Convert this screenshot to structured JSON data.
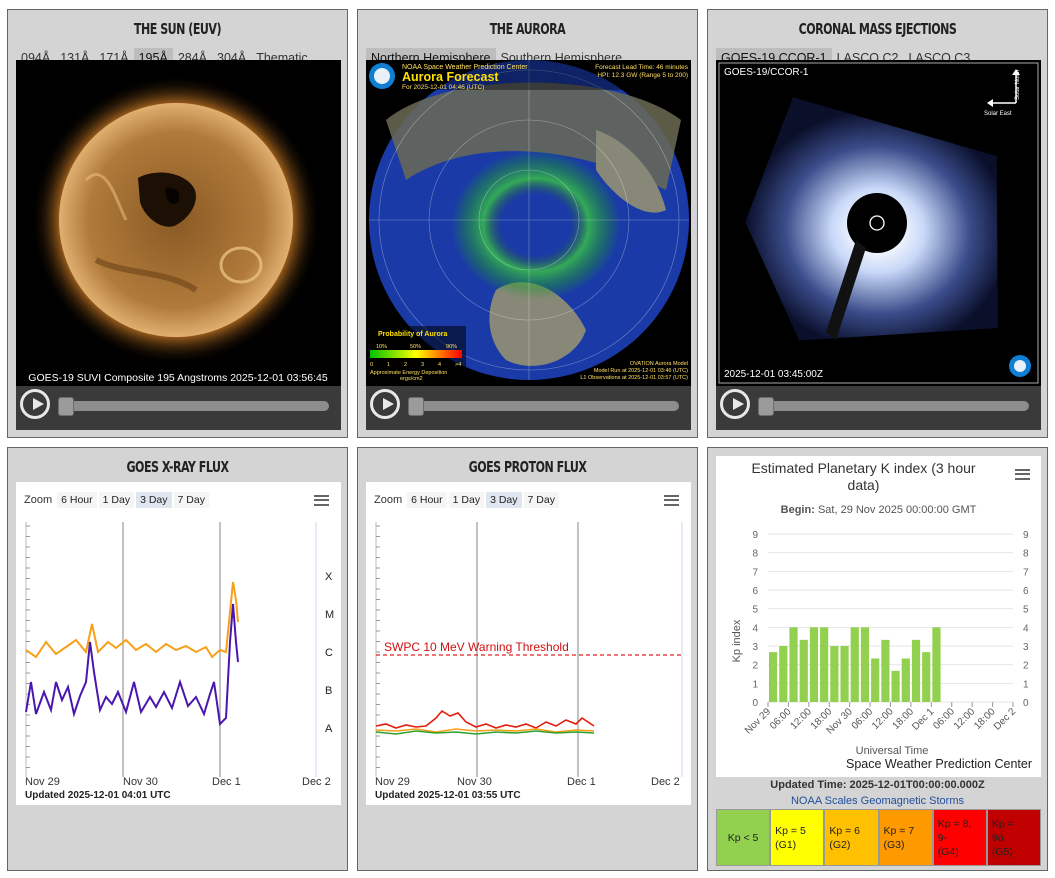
{
  "sun": {
    "title": "THE SUN (EUV)",
    "tabs": [
      "094Å",
      "131Å",
      "171Å",
      "195Å",
      "284Å",
      "304Å",
      "Thematic"
    ],
    "selected_tab": "195Å",
    "caption": "GOES-19 SUVI Composite 195 Angstroms 2025-12-01 03:56:45"
  },
  "aurora": {
    "title": "THE AURORA",
    "tabs": [
      "Northern Hemisphere",
      "Southern Hemisphere"
    ],
    "selected_tab": "Northern Hemisphere",
    "org": "NOAA Space Weather Prediction Center",
    "forecast_title": "Aurora Forecast",
    "for_date": "For 2025-12-01 04:46 (UTC)",
    "lead_time": "Forecast Lead Time:  46 minutes",
    "hpi": "HPI:  12.3 GW (Range 5 to 200)",
    "legend_title": "Probability of Aurora",
    "legend_pcts": [
      "10%",
      "50%",
      "90%"
    ],
    "legend_scale": [
      "0",
      "1",
      "2",
      "3",
      "4",
      ">4"
    ],
    "legend_caption1": "Approximate Energy Deposition",
    "legend_caption2": "ergs/cm2",
    "model_lines": [
      "OVATION Aurora Model",
      "Model Run at 2025-12-01 03:46 (UTC)",
      "L1 Observations at 2025-12-01 03:57 (UTC)"
    ]
  },
  "cme": {
    "title": "CORONAL MASS EJECTIONS",
    "tabs": [
      "GOES-19 CCOR-1",
      "LASCO C2",
      "LASCO C3"
    ],
    "selected_tab": "GOES-19 CCOR-1",
    "label": "GOES-19/CCOR-1",
    "timestamp": "2025-12-01 03:45:00Z",
    "compass_north": "Solar North",
    "compass_east": "Solar East"
  },
  "xray": {
    "title": "GOES X-RAY FLUX",
    "zoom_label": "Zoom",
    "zoom_options": [
      "6 Hour",
      "1 Day",
      "3 Day",
      "7 Day"
    ],
    "zoom_selected": "3 Day",
    "flare_classes": [
      "X",
      "M",
      "C",
      "B",
      "A"
    ],
    "x_ticks": [
      "Nov 29",
      "Nov 30",
      "Dec 1",
      "Dec 2"
    ],
    "updated": "Updated 2025-12-01 04:01 UTC"
  },
  "proton": {
    "title": "GOES PROTON FLUX",
    "zoom_label": "Zoom",
    "zoom_options": [
      "6 Hour",
      "1 Day",
      "3 Day",
      "7 Day"
    ],
    "zoom_selected": "3 Day",
    "threshold_label": "SWPC 10 MeV Warning Threshold",
    "x_ticks": [
      "Nov 29",
      "Nov 30",
      "Dec 1",
      "Dec 2"
    ],
    "updated": "Updated 2025-12-01 03:55 UTC"
  },
  "kp": {
    "title_line1": "Estimated Planetary K index (3 hour",
    "title_line2": "data)",
    "begin_label": "Begin:",
    "begin_value": "Sat, 29 Nov 2025 00:00:00 GMT",
    "y_label": "Kp index",
    "x_label": "Universal Time",
    "credit": "Space Weather Prediction Center",
    "updated": "Updated Time: 2025-12-01T00:00:00.000Z",
    "scales_link": "NOAA Scales Geomagnetic Storms",
    "legend": [
      {
        "line1": "Kp < 5",
        "line2": "",
        "color": "#92d050"
      },
      {
        "line1": "Kp = 5",
        "line2": "(G1)",
        "color": "#ffff00"
      },
      {
        "line1": "Kp = 6",
        "line2": "(G2)",
        "color": "#ffc000"
      },
      {
        "line1": "Kp = 7",
        "line2": "(G3)",
        "color": "#ff9900"
      },
      {
        "line1": "Kp = 8, 9-",
        "line2": "(G4)",
        "color": "#ff0000"
      },
      {
        "line1": "Kp =",
        "line2": "9o",
        "line3": "(G5)",
        "color": "#c00000"
      }
    ]
  },
  "chart_data": [
    {
      "type": "bar",
      "title": "Estimated Planetary K index (3 hour data)",
      "ylabel": "Kp index",
      "xlabel": "Universal Time",
      "ylim": [
        0,
        9
      ],
      "x_ticks": [
        "Nov 29",
        "06:00",
        "12:00",
        "18:00",
        "Nov 30",
        "06:00",
        "12:00",
        "18:00",
        "Dec 1",
        "06:00",
        "12:00",
        "18:00",
        "Dec 2"
      ],
      "values": [
        2.67,
        3.0,
        4.0,
        3.33,
        4.0,
        4.0,
        3.0,
        3.0,
        4.0,
        4.0,
        2.33,
        3.33,
        1.67,
        2.33,
        3.33,
        2.67,
        4.0
      ],
      "color": "#92d050"
    }
  ]
}
